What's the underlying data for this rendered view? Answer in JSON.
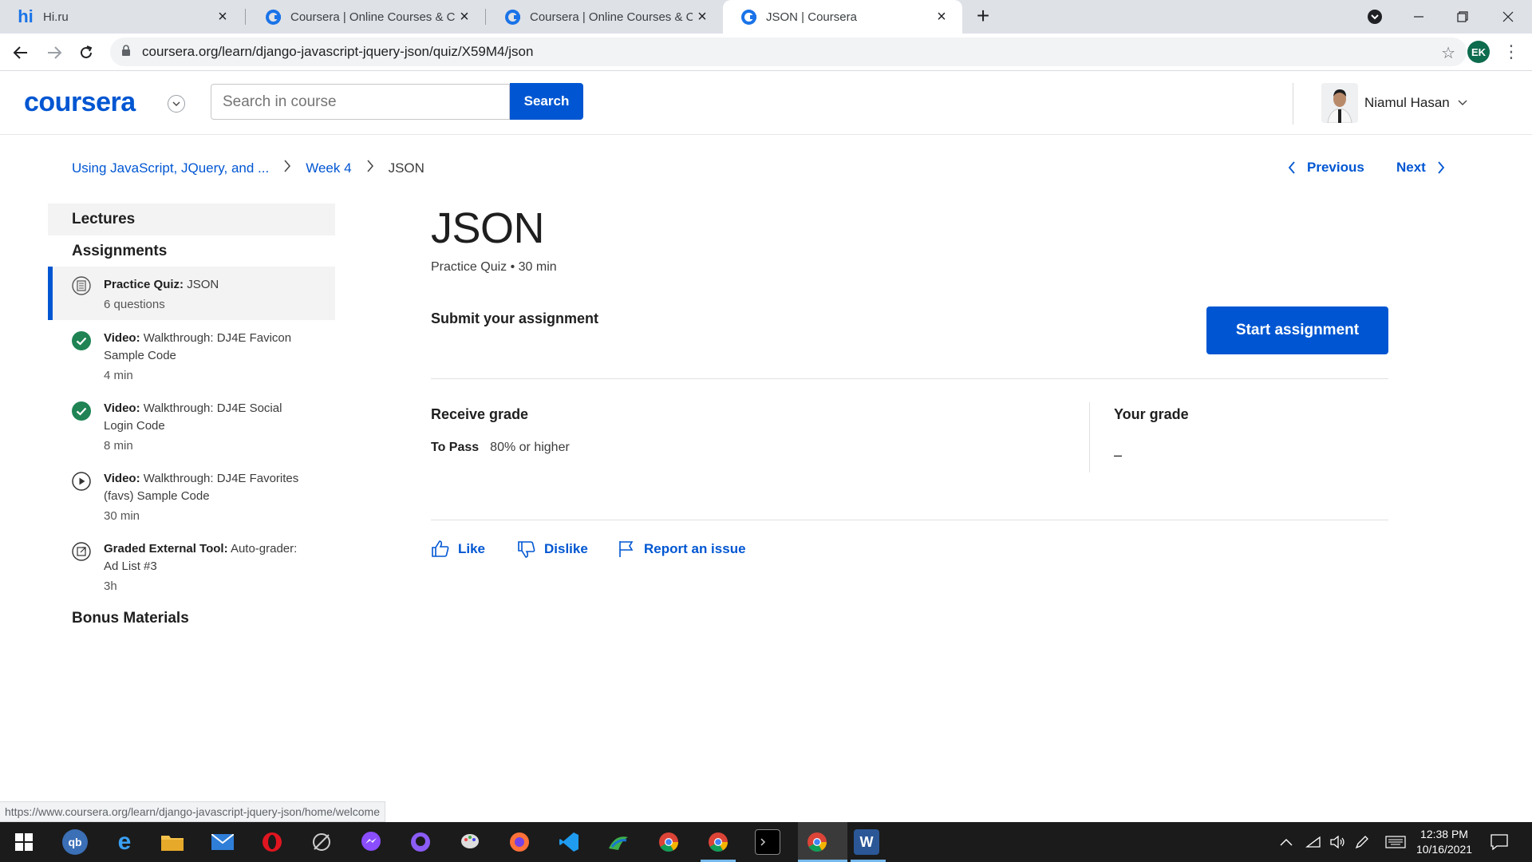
{
  "browser": {
    "tabs": [
      {
        "title": "Hi.ru",
        "active": false
      },
      {
        "title": "Coursera | Online Courses & Cre",
        "active": false
      },
      {
        "title": "Coursera | Online Courses & Cre",
        "active": false
      },
      {
        "title": "JSON | Coursera",
        "active": true
      }
    ],
    "url": "coursera.org/learn/django-javascript-jquery-json/quiz/X59M4/json",
    "profile_initials": "EK",
    "status_url": "https://www.coursera.org/learn/django-javascript-jquery-json/home/welcome"
  },
  "header": {
    "logo": "coursera",
    "search_placeholder": "Search in course",
    "search_button": "Search",
    "user_name": "Niamul Hasan"
  },
  "breadcrumb": {
    "course": "Using JavaScript, JQuery, and ...",
    "week": "Week 4",
    "current": "JSON"
  },
  "pager": {
    "previous": "Previous",
    "next": "Next"
  },
  "sidebar": {
    "lectures": "Lectures",
    "assignments": "Assignments",
    "items": [
      {
        "type": "Practice Quiz:",
        "title": "JSON",
        "meta": "6 questions",
        "icon": "quiz-icon",
        "active": true
      },
      {
        "type": "Video:",
        "title": "Walkthrough: DJ4E Favicon Sample Code",
        "meta": "4 min",
        "icon": "check-circle-icon",
        "active": false
      },
      {
        "type": "Video:",
        "title": "Walkthrough: DJ4E Social Login Code",
        "meta": "8 min",
        "icon": "check-circle-icon",
        "active": false
      },
      {
        "type": "Video:",
        "title": "Walkthrough: DJ4E Favorites (favs) Sample Code",
        "meta": "30 min",
        "icon": "play-circle-icon",
        "active": false
      },
      {
        "type": "Graded External Tool:",
        "title": "Auto-grader: Ad List #3",
        "meta": "3h",
        "icon": "external-tool-icon",
        "active": false
      }
    ],
    "bonus": "Bonus Materials"
  },
  "main": {
    "title": "JSON",
    "subtitle": "Practice Quiz • 30 min",
    "submit_label": "Submit your assignment",
    "start_button": "Start assignment",
    "receive_grade": "Receive grade",
    "to_pass_label": "To Pass",
    "to_pass_value": "80% or higher",
    "your_grade": "Your grade",
    "your_grade_value": "–",
    "actions": {
      "like": "Like",
      "dislike": "Dislike",
      "report": "Report an issue"
    }
  },
  "taskbar": {
    "time": "12:38 PM",
    "date": "10/16/2021",
    "apps": [
      "windows-start-icon",
      "qbittorrent-icon",
      "edge-icon",
      "file-explorer-icon",
      "mail-icon",
      "opera-icon",
      "app-icon",
      "messenger-icon",
      "github-icon",
      "paint-icon",
      "firefox-icon",
      "vscode-icon",
      "maps-icon",
      "chrome-icon",
      "chrome-icon",
      "terminal-icon",
      "chrome-profile-icon",
      "word-icon"
    ]
  },
  "colors": {
    "brand": "#0056d2",
    "success": "#1f8354",
    "tabstrip": "#dee1e6"
  }
}
